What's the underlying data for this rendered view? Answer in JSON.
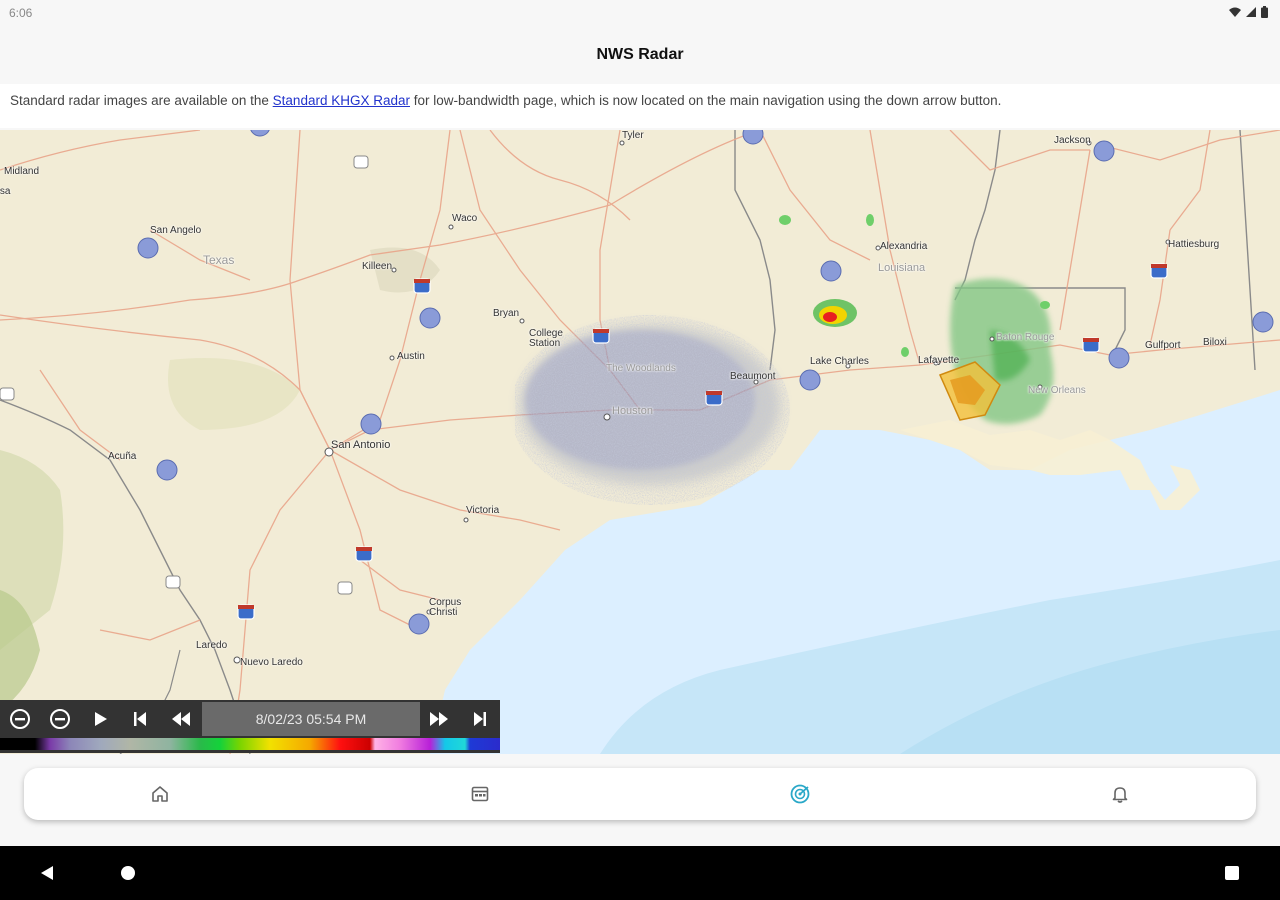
{
  "status_bar": {
    "time": "6:06",
    "icons": [
      "wifi-icon",
      "signal-icon",
      "battery-icon"
    ]
  },
  "app": {
    "title": "NWS Radar"
  },
  "notice": {
    "text_before": "Standard radar images are available on the ",
    "link_text": "Standard KHGX Radar",
    "text_after": " for low-bandwidth page, which is now located on the main navigation using the down arrow button."
  },
  "map": {
    "state_labels": {
      "texas": "Texas",
      "louisiana": "Louisiana"
    },
    "cities": {
      "midland": "Midland",
      "odessa": "Odessa",
      "san_angelo": "San Angelo",
      "tyler": "Tyler",
      "waco": "Waco",
      "killeen": "Killeen",
      "bryan": "Bryan",
      "college_station": "College Station",
      "austin": "Austin",
      "san_antonio": "San Antonio",
      "the_woodlands": "The Woodlands",
      "houston": "Houston",
      "beaumont": "Beaumont",
      "lake_charles": "Lake Charles",
      "lafayette": "Lafayette",
      "baton_rouge": "Baton Rouge",
      "new_orleans": "New Orleans",
      "alexandria": "Alexandria",
      "jackson": "Jackson",
      "hattiesburg": "Hattiesburg",
      "gulfport": "Gulfport",
      "biloxi": "Biloxi",
      "acuna": "Acuña",
      "victoria": "Victoria",
      "corpus_christi": "Corpus Christi",
      "laredo": "Laredo",
      "nuevo_laredo": "Nuevo Laredo"
    },
    "highway_shields": [
      "20",
      "35",
      "45",
      "10",
      "10",
      "37",
      "59",
      "35",
      "12",
      "59"
    ]
  },
  "controls": {
    "timestamp": "8/02/23 05:54 PM",
    "buttons": [
      "zoom-in-icon",
      "zoom-out-icon",
      "play-icon",
      "skip-to-start-icon",
      "step-back-icon",
      "step-forward-icon",
      "skip-to-end-icon"
    ]
  },
  "bottom_nav": {
    "items": [
      "home-icon",
      "calendar-icon",
      "radar-icon",
      "bell-icon"
    ],
    "active": "radar-icon",
    "active_color": "#2aa8c8"
  }
}
